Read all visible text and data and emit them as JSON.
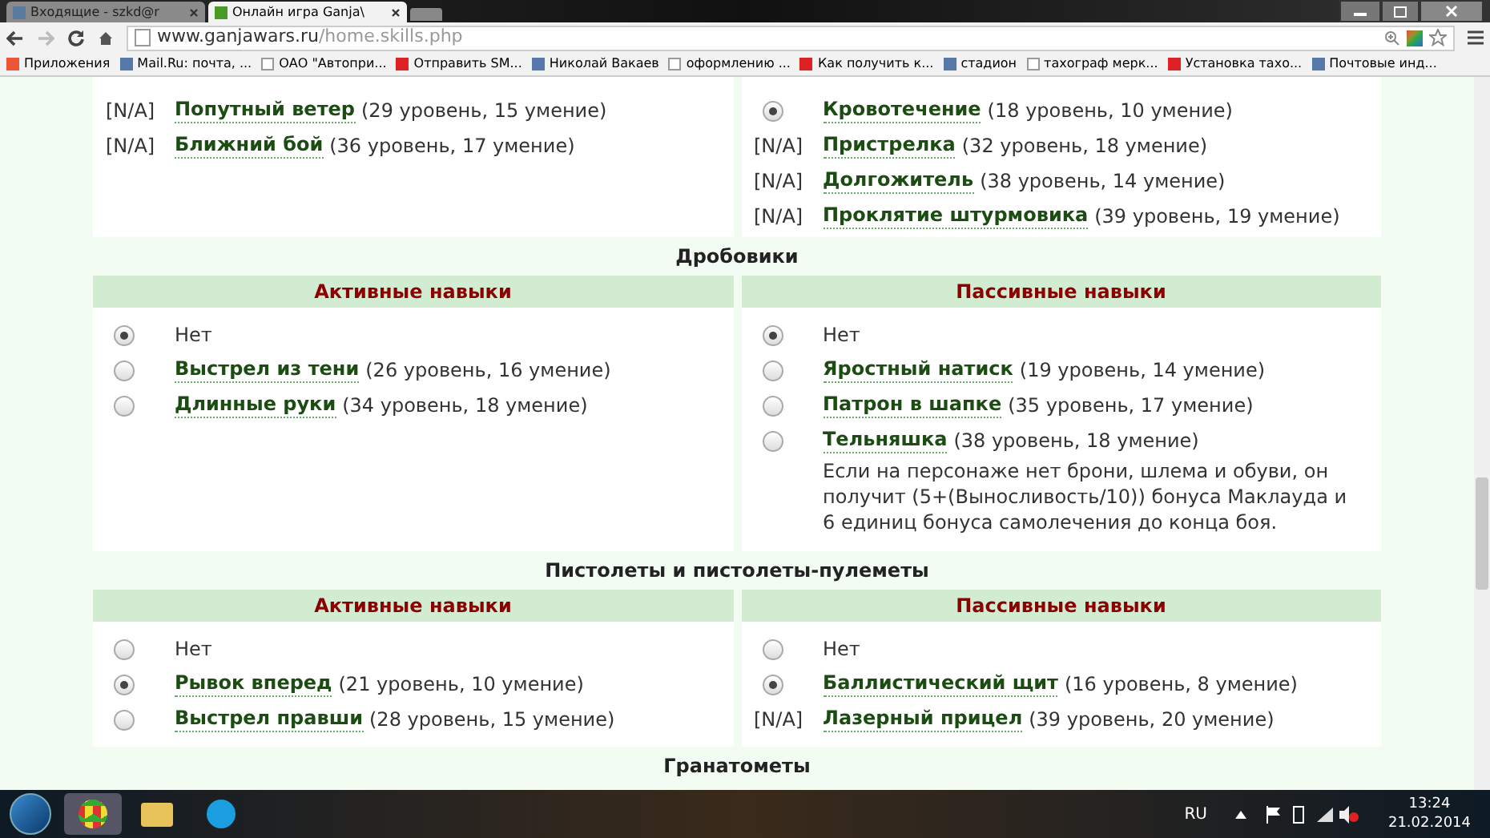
{
  "browser": {
    "tabs": [
      {
        "title": "Входящие - szkd@r",
        "selected": false
      },
      {
        "title": "Онлайн игра Ganja\\",
        "selected": true
      }
    ],
    "address": {
      "host": "www.ganjawars.ru",
      "path": "/home.skills.php"
    },
    "bookmarks": [
      "Приложения",
      "Mail.Ru: почта, ...",
      "ОАО \"Автопри...",
      "Отправить SM...",
      "Николай Вакаев",
      "оформлению ...",
      "Как получить к...",
      "стадион",
      "тахограф мерк...",
      "Установка тахо...",
      "Почтовые инд..."
    ]
  },
  "sections": [
    {
      "columns": [
        {
          "items": [
            {
              "kind": "na",
              "prefix": "[N/A]",
              "name": "Попутный ветер",
              "detail": "(29 уровень, 15 умение)"
            },
            {
              "kind": "na",
              "prefix": "[N/A]",
              "name": "Ближний бой",
              "detail": "(36 уровень, 17 умение)"
            }
          ]
        },
        {
          "items": [
            {
              "kind": "radio",
              "selected": true,
              "name": "Кровотечение",
              "detail": "(18 уровень, 10 умение)"
            },
            {
              "kind": "na",
              "prefix": "[N/A]",
              "name": "Пристрелка",
              "detail": "(32 уровень, 18 умение)"
            },
            {
              "kind": "na",
              "prefix": "[N/A]",
              "name": "Долгожитель",
              "detail": "(38 уровень, 14 умение)"
            },
            {
              "kind": "na",
              "prefix": "[N/A]",
              "name": "Проклятие штурмовика",
              "detail": "(39 уровень, 19 умение)"
            }
          ]
        }
      ]
    },
    {
      "title": "Дробовики",
      "columns": [
        {
          "header": "Активные навыки",
          "items": [
            {
              "kind": "radio",
              "selected": true,
              "name": "Нет"
            },
            {
              "kind": "radio",
              "selected": false,
              "name": "Выстрел из тени",
              "detail": "(26 уровень, 16 умение)"
            },
            {
              "kind": "radio",
              "selected": false,
              "name": "Длинные руки",
              "detail": "(34 уровень, 18 умение)"
            }
          ]
        },
        {
          "header": "Пассивные навыки",
          "items": [
            {
              "kind": "radio",
              "selected": true,
              "name": "Нет"
            },
            {
              "kind": "radio",
              "selected": false,
              "name": "Яростный натиск",
              "detail": "(19 уровень, 14 умение)"
            },
            {
              "kind": "radio",
              "selected": false,
              "name": "Патрон в шапке",
              "detail": "(35 уровень, 17 умение)"
            },
            {
              "kind": "radio",
              "selected": false,
              "name": "Тельняшка",
              "detail": "(38 уровень, 18 умение)",
              "description": "Если на персонаже нет брони, шлема и обуви, он получит (5+(Выносливость/10)) бонуса Маклауда и 6 единиц бонуса самолечения до конца боя."
            }
          ]
        }
      ]
    },
    {
      "title": "Пистолеты и пистолеты-пулеметы",
      "columns": [
        {
          "header": "Активные навыки",
          "items": [
            {
              "kind": "radio",
              "selected": false,
              "name": "Нет"
            },
            {
              "kind": "radio",
              "selected": true,
              "name": "Рывок вперед",
              "detail": "(21 уровень, 10 умение)"
            },
            {
              "kind": "radio",
              "selected": false,
              "name": "Выстрел правши",
              "detail": "(28 уровень, 15 умение)"
            }
          ]
        },
        {
          "header": "Пассивные навыки",
          "items": [
            {
              "kind": "radio",
              "selected": false,
              "name": "Нет"
            },
            {
              "kind": "radio",
              "selected": true,
              "name": "Баллистический щит",
              "detail": "(16 уровень, 8 умение)"
            },
            {
              "kind": "na",
              "prefix": "[N/A]",
              "name": "Лазерный прицел",
              "detail": "(39 уровень, 20 умение)"
            }
          ]
        }
      ]
    },
    {
      "title": "Гранатометы"
    }
  ],
  "taskbar": {
    "language": "RU",
    "time": "13:24",
    "date": "21.02.2014"
  }
}
